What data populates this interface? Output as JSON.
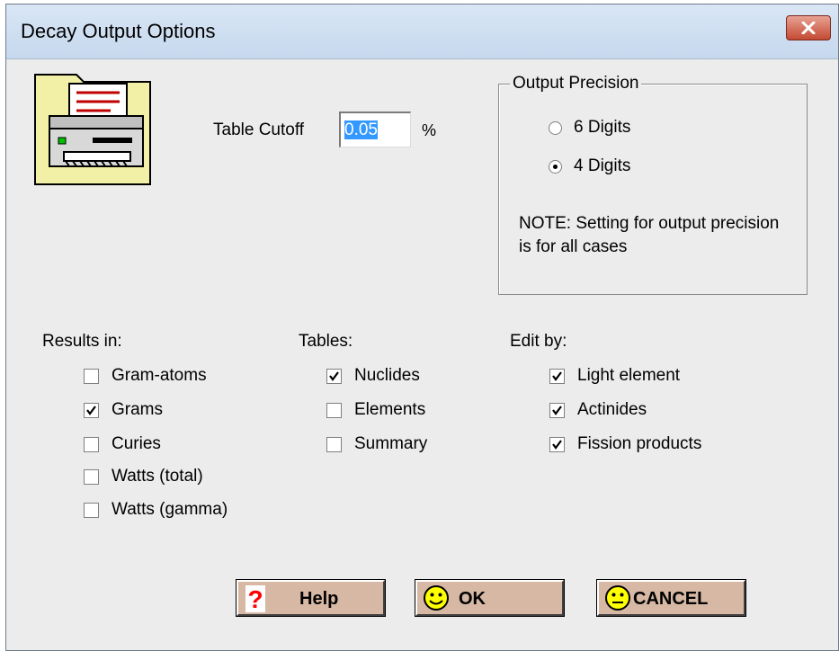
{
  "window": {
    "title": "Decay Output Options"
  },
  "icons": {
    "close": "close-icon",
    "printer": "printer-icon",
    "help": "question-mark-icon",
    "smiley": "smiley-face-icon"
  },
  "cutoff": {
    "label": "Table Cutoff",
    "value": "0.05",
    "unit": "%"
  },
  "precision": {
    "legend": "Output Precision",
    "options": [
      {
        "label": "6 Digits",
        "selected": false
      },
      {
        "label": "4 Digits",
        "selected": true
      }
    ],
    "note": "NOTE: Setting for output precision is for all cases"
  },
  "results": {
    "title": "Results in:",
    "items": [
      {
        "label": "Gram-atoms",
        "checked": false
      },
      {
        "label": "Grams",
        "checked": true
      },
      {
        "label": "Curies",
        "checked": false
      },
      {
        "label": "Watts (total)",
        "checked": false
      },
      {
        "label": "Watts (gamma)",
        "checked": false
      }
    ]
  },
  "tables": {
    "title": "Tables:",
    "items": [
      {
        "label": "Nuclides",
        "checked": true
      },
      {
        "label": "Elements",
        "checked": false
      },
      {
        "label": "Summary",
        "checked": false
      }
    ]
  },
  "edit": {
    "title": "Edit by:",
    "items": [
      {
        "label": "Light element",
        "checked": true
      },
      {
        "label": "Actinides",
        "checked": true
      },
      {
        "label": "Fission products",
        "checked": true
      }
    ]
  },
  "buttons": {
    "help": "Help",
    "ok": "OK",
    "cancel": "CANCEL"
  },
  "colors": {
    "button_bg": "#d7b8a4",
    "smiley": "#ffff00",
    "help_icon": "#ff0000",
    "icon_bg": "#f2efa6"
  }
}
